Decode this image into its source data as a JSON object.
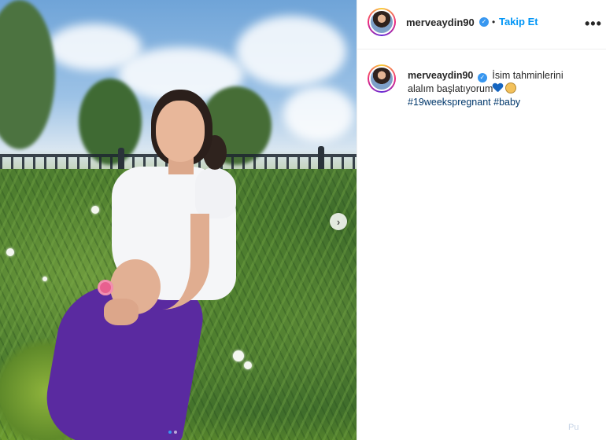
{
  "post": {
    "username": "merveaydin90",
    "separator": "•",
    "follow_label": "Takip Et",
    "more_label": "•••",
    "caption": {
      "text": "İsim tahminlerini alalım başlatıyorum",
      "hashtags": [
        "#19weekspregnant",
        "#baby"
      ]
    },
    "corner_text": "Pu"
  },
  "icons": {
    "verified": "verified-badge-icon",
    "more": "more-options-icon",
    "next": "chevron-right-icon",
    "heart": "blue-heart-emoji",
    "baby": "baby-face-emoji"
  },
  "colors": {
    "follow_blue": "#0095f6",
    "hashtag": "#00376b",
    "verified": "#3897f0"
  }
}
